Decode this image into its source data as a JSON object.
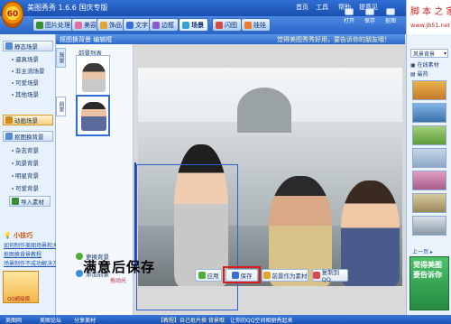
{
  "titlebar": {
    "title": "美图秀秀 1.6.6 国庆专版",
    "menu": [
      "首页",
      "工具",
      "帮助",
      "提意见"
    ],
    "logo": "60"
  },
  "tabs": [
    {
      "label": "图片处理"
    },
    {
      "label": "美容"
    },
    {
      "label": "饰品"
    },
    {
      "label": "文字"
    },
    {
      "label": "边框"
    },
    {
      "label": "场景"
    },
    {
      "label": "闪图"
    },
    {
      "label": "娃娃"
    }
  ],
  "toolbar": {
    "open": "打开",
    "save": "保存",
    "screenshot": "抠图"
  },
  "header": {
    "title": "抠图换背景  编辑框",
    "promo": "觉得美图秀秀好用，要告诉你的朋友哦！"
  },
  "watermark": {
    "line1": "脚 本 之 家",
    "line2": "www.jb51.net"
  },
  "left_panel": {
    "categories": [
      {
        "label": "静态场景"
      },
      {
        "label": "动画场景"
      },
      {
        "label": "抠图换背景"
      }
    ],
    "static_items": [
      "逼真场景",
      "非主流场景",
      "可爱场景",
      "其他场景"
    ],
    "bg_items": [
      "杂志背景",
      "风景背景",
      "明星背景",
      "可爱背景"
    ],
    "import_label": "导入素材",
    "tips_title": "小技巧",
    "tips": [
      "如何制作美图场景和大头贴",
      "抠图换背景教程",
      "场景制作不成功解决方法"
    ]
  },
  "material_panel": {
    "tab1": "背景",
    "tab2": "前景",
    "list_title": "前景列表",
    "change_bg": "更换背景",
    "add_fg": "添加前景"
  },
  "canvas_bottom": {
    "apply": "应用",
    "save": "保存",
    "save_as_material": "前景作为素材",
    "copy": "复制到QQ"
  },
  "right_panel": {
    "dropdown": "风景背景",
    "online_label": "在线素材",
    "latest_label": "最热",
    "prev": "上一页",
    "banner_line1": "觉得美图",
    "banner_line2": "要告诉你"
  },
  "statusbar": {
    "home": "美图网",
    "forum": "美图论坛",
    "share": "分享美材",
    "notice": "【教程】自己抠片换 背景哦",
    "qq": "让你的QQ空间相册秀起来",
    "bar": "QQ超级版"
  },
  "annotation": {
    "text": "满意后保存",
    "cursor": "拖动光"
  }
}
